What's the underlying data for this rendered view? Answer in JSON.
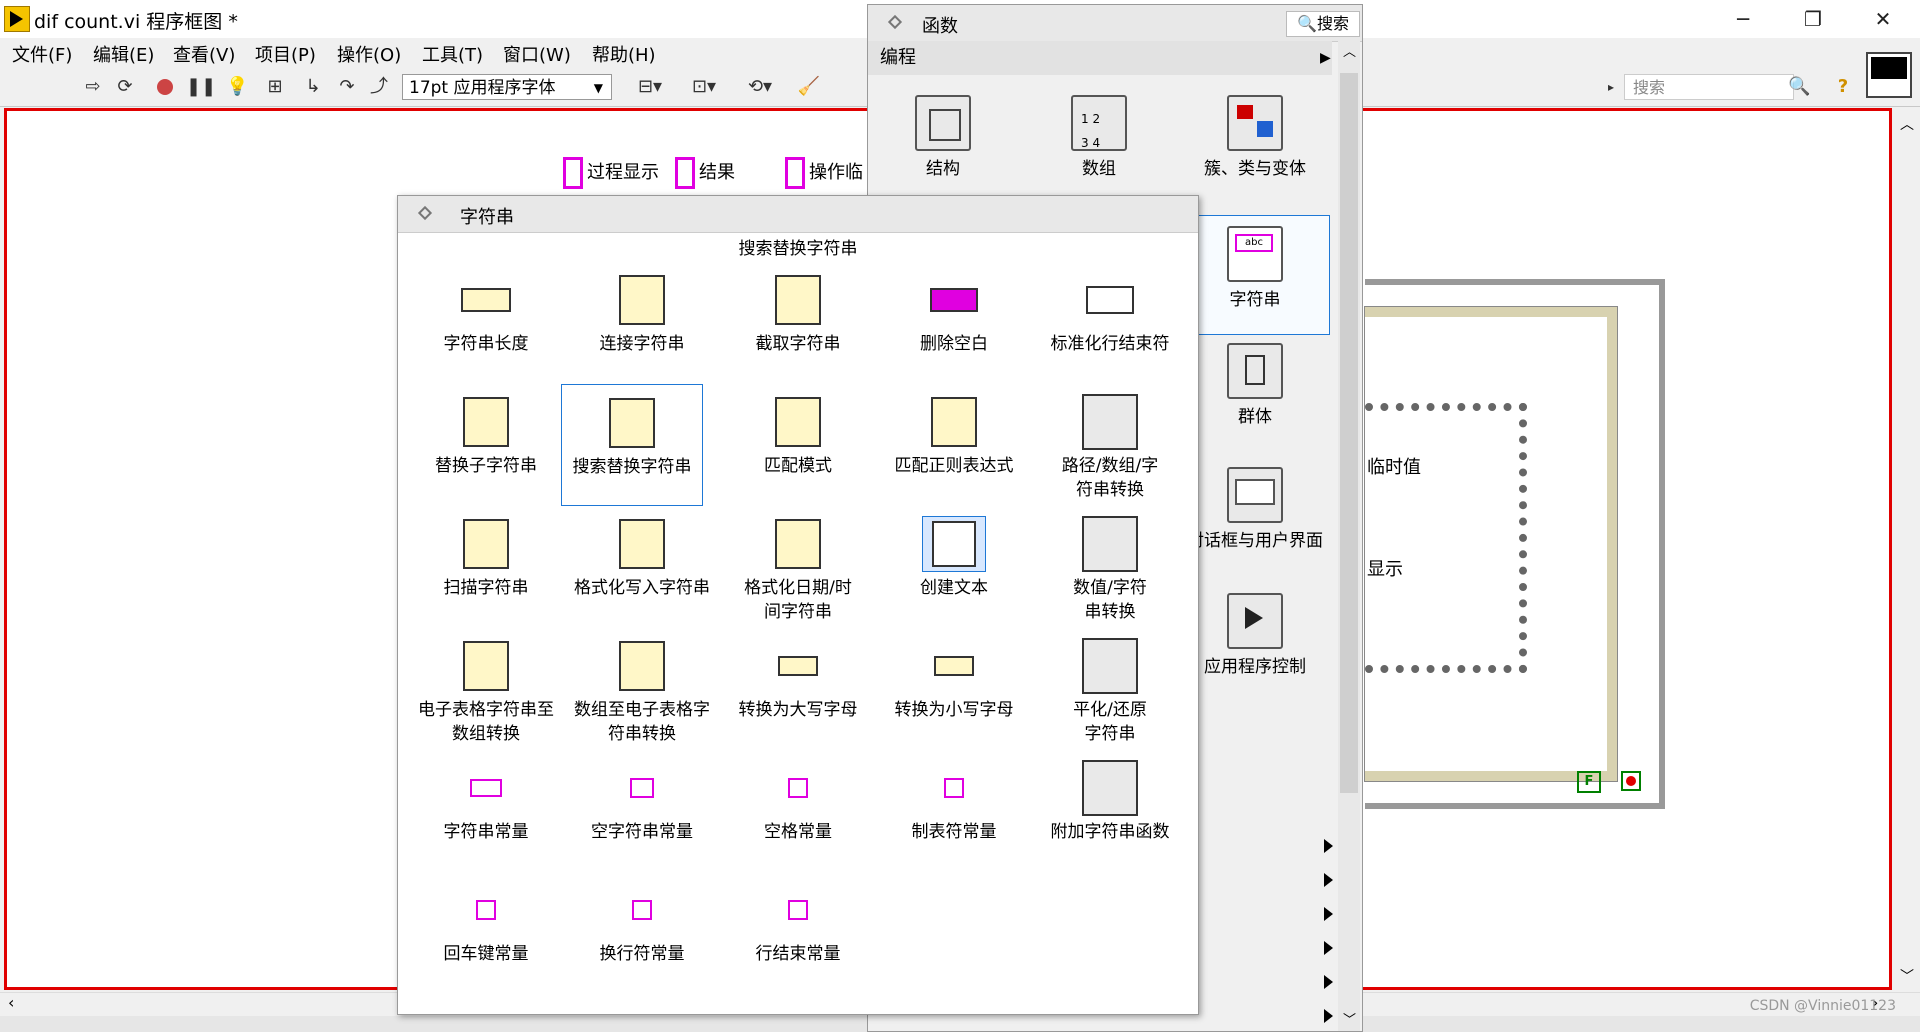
{
  "window": {
    "title": "dif count.vi 程序框图 *",
    "minimize": "─",
    "restore": "❐",
    "close": "✕"
  },
  "menu": [
    "文件(F)",
    "编辑(E)",
    "查看(V)",
    "项目(P)",
    "操作(O)",
    "工具(T)",
    "窗口(W)",
    "帮助(H)"
  ],
  "toolbar": {
    "font": "17pt 应用程序字体",
    "search_placeholder": "搜索"
  },
  "diagram": {
    "indicators": [
      "过程显示",
      "结果",
      "操作临"
    ],
    "partial_labels": [
      "临时值",
      "显示"
    ],
    "constant_false": "F"
  },
  "functions_palette": {
    "title": "函数",
    "search_label": "搜索",
    "category": "编程",
    "items": [
      {
        "label": "结构",
        "icon": "structure-icon"
      },
      {
        "label": "数组",
        "icon": "array-icon"
      },
      {
        "label": "簇、类与变体",
        "icon": "cluster-icon"
      },
      {
        "label": "字符串",
        "icon": "string-icon"
      },
      {
        "label": "群体",
        "icon": "collection-icon"
      },
      {
        "label": "对话框与用户界面",
        "icon": "dialog-icon"
      },
      {
        "label": "应用程序控制",
        "icon": "app-control-icon"
      }
    ]
  },
  "string_palette": {
    "title": "字符串",
    "tooltip": "搜索替换字符串",
    "items": [
      {
        "label": "字符串长度",
        "icon": "string-length-icon"
      },
      {
        "label": "连接字符串",
        "icon": "concatenate-icon"
      },
      {
        "label": "截取字符串",
        "icon": "string-subset-icon"
      },
      {
        "label": "删除空白",
        "icon": "trim-whitespace-icon"
      },
      {
        "label": "标准化行结束符",
        "icon": "normalize-eol-icon"
      },
      {
        "label": "替换子字符串",
        "icon": "replace-substring-icon"
      },
      {
        "label": "搜索替换字符串",
        "icon": "search-replace-icon"
      },
      {
        "label": "匹配模式",
        "icon": "match-pattern-icon"
      },
      {
        "label": "匹配正则表达式",
        "icon": "match-regex-icon"
      },
      {
        "label": "路径/数组/字符串转换",
        "icon": "path-array-string-icon"
      },
      {
        "label": "扫描字符串",
        "icon": "scan-string-icon"
      },
      {
        "label": "格式化写入字符串",
        "icon": "format-into-string-icon"
      },
      {
        "label": "格式化日期/时间字符串",
        "icon": "format-date-icon"
      },
      {
        "label": "创建文本",
        "icon": "build-text-icon"
      },
      {
        "label": "数值/字符串转换",
        "icon": "number-string-icon"
      },
      {
        "label": "电子表格字符串至数组转换",
        "icon": "spreadsheet-to-array-icon"
      },
      {
        "label": "数组至电子表格字符串转换",
        "icon": "array-to-spreadsheet-icon"
      },
      {
        "label": "转换为大写字母",
        "icon": "to-upper-icon"
      },
      {
        "label": "转换为小写字母",
        "icon": "to-lower-icon"
      },
      {
        "label": "平化/还原字符串",
        "icon": "flatten-icon"
      },
      {
        "label": "字符串常量",
        "icon": "string-constant-icon"
      },
      {
        "label": "空字符串常量",
        "icon": "empty-string-icon"
      },
      {
        "label": "空格常量",
        "icon": "space-constant-icon"
      },
      {
        "label": "制表符常量",
        "icon": "tab-constant-icon"
      },
      {
        "label": "附加字符串函数",
        "icon": "additional-string-icon"
      },
      {
        "label": "回车键常量",
        "icon": "carriage-return-icon"
      },
      {
        "label": "换行符常量",
        "icon": "line-feed-icon"
      },
      {
        "label": "行结束常量",
        "icon": "eol-constant-icon"
      }
    ]
  },
  "watermark": "CSDN @Vinnie01123",
  "colors": {
    "border_red": "#e00000",
    "magenta": "#e000e0",
    "selection": "#1e78d6"
  }
}
